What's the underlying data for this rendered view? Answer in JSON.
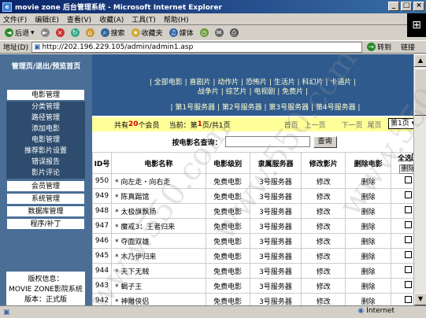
{
  "window": {
    "title": "movie zone 后台管理系统 - Microsoft Internet Explorer"
  },
  "menu": [
    "文件(F)",
    "编辑(E)",
    "查看(V)",
    "收藏(A)",
    "工具(T)",
    "帮助(H)"
  ],
  "toolbar": {
    "back": "后退",
    "search": "搜索",
    "favorites": "收藏夹",
    "media": "媒体"
  },
  "address": {
    "label": "地址(D)",
    "url": "http://202.196.229.105/admin/admin1.asp",
    "go": "转到",
    "links": "链接"
  },
  "sidebar": {
    "header": "管理页/退出/预览首页",
    "sections": [
      {
        "title": "电影管理",
        "items": [
          "分类管理",
          "路径管理",
          "添加电影",
          "电影管理",
          "推荐影片设置",
          "错误报告",
          "影片评论"
        ]
      },
      {
        "title": "会员管理",
        "items": []
      },
      {
        "title": "系统管理",
        "items": []
      },
      {
        "title": "数据库管理",
        "items": []
      },
      {
        "title": "程序/补丁",
        "items": []
      }
    ],
    "info": [
      "版权信息：",
      "MOVIE ZONE影院系统",
      "版本：正式版"
    ]
  },
  "main": {
    "categories": "| 全部电影 | 喜剧片 | 动作片 | 恐怖片 | 生活片 | 科幻片 | 卡通片 | 战争片 | 综艺片 | 电视剧 | 免费片 |",
    "servers": "| 第1号服务器 | 第2号服务器 | 第3号服务器 | 第4号服务器 |",
    "pager": {
      "prefix": "共有",
      "count": "20",
      "suffix": "个会员",
      "current_label": "当前：第",
      "current": "1",
      "total": "页/共1页",
      "first": "首页",
      "prev": "上一页",
      "next": "下一页",
      "last": "尾页",
      "select": "第1页"
    },
    "search": {
      "label": "按电影名查询：",
      "button": "查询"
    },
    "table": {
      "headers": [
        "ID号",
        "电影名称",
        "电影级别",
        "隶属服务器",
        "修改影片",
        "删除电影",
        "全选"
      ],
      "delete_button": "删除",
      "rows": [
        {
          "id": "950",
          "name": "向左走・向右走",
          "level": "免费电影",
          "server": "3号服务器",
          "edit": "修改",
          "del": "删除"
        },
        {
          "id": "949",
          "name": "陈真踢馆",
          "level": "免费电影",
          "server": "3号服务器",
          "edit": "修改",
          "del": "删除"
        },
        {
          "id": "948",
          "name": "太极旗飘扬",
          "level": "免费电影",
          "server": "3号服务器",
          "edit": "修改",
          "del": "删除"
        },
        {
          "id": "947",
          "name": "魔戒3：王者归来",
          "level": "免费电影",
          "server": "3号服务器",
          "edit": "修改",
          "del": "删除"
        },
        {
          "id": "946",
          "name": "夺面双雄",
          "level": "免费电影",
          "server": "3号服务器",
          "edit": "修改",
          "del": "删除"
        },
        {
          "id": "945",
          "name": "木乃伊归来",
          "level": "免费电影",
          "server": "3号服务器",
          "edit": "修改",
          "del": "删除"
        },
        {
          "id": "944",
          "name": "天下无贼",
          "level": "免费电影",
          "server": "3号服务器",
          "edit": "修改",
          "del": "删除"
        },
        {
          "id": "943",
          "name": "蝎子王",
          "level": "免费电影",
          "server": "3号服务器",
          "edit": "修改",
          "del": "删除"
        },
        {
          "id": "942",
          "name": "神雕侠侣",
          "level": "免费电影",
          "server": "3号服务器",
          "edit": "修改",
          "del": "删除"
        }
      ]
    }
  },
  "status": {
    "zone": "Internet"
  },
  "watermark": "www.550.com"
}
